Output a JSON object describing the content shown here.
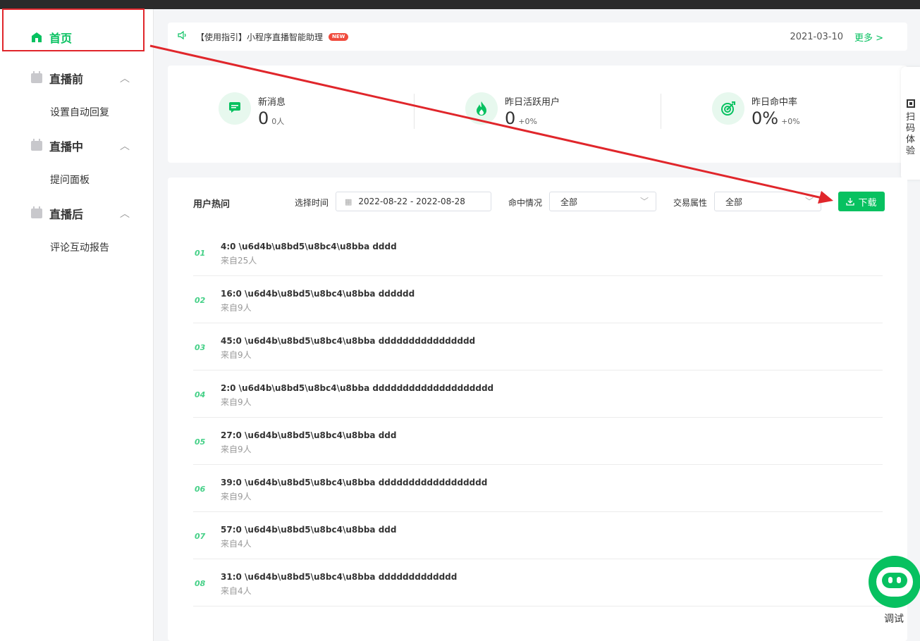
{
  "sidebar": {
    "home_label": "首页",
    "groups": [
      {
        "label": "直播前",
        "sub": "设置自动回复"
      },
      {
        "label": "直播中",
        "sub": "提问面板"
      },
      {
        "label": "直播后",
        "sub": "评论互动报告"
      }
    ]
  },
  "notice": {
    "text": "【使用指引】小程序直播智能助理",
    "badge": "NEW",
    "date": "2021-03-10",
    "more": "更多 >"
  },
  "stats": [
    {
      "title": "新消息",
      "value": "0",
      "sub": "0人"
    },
    {
      "title": "昨日活跃用户",
      "value": "0",
      "sub": "+0%"
    },
    {
      "title": "昨日命中率",
      "value": "0%",
      "sub": "+0%"
    }
  ],
  "side_float": {
    "text": "扫码体验"
  },
  "panel": {
    "title": "用户热问",
    "time_label": "选择时间",
    "date_range": "2022-08-22 - 2022-08-28",
    "hit_label": "命中情况",
    "hit_value": "全部",
    "trade_label": "交易属性",
    "trade_value": "全部",
    "download_label": "下载"
  },
  "questions": [
    {
      "num": "01",
      "title": "4:0 \\u6d4b\\u8bd5\\u8bc4\\u8bba dddd",
      "from": "来自25人"
    },
    {
      "num": "02",
      "title": "16:0 \\u6d4b\\u8bd5\\u8bc4\\u8bba dddddd",
      "from": "来自9人"
    },
    {
      "num": "03",
      "title": "45:0 \\u6d4b\\u8bd5\\u8bc4\\u8bba dddddddddddddddd",
      "from": "来自9人"
    },
    {
      "num": "04",
      "title": "2:0 \\u6d4b\\u8bd5\\u8bc4\\u8bba dddddddddddddddddddd",
      "from": "来自9人"
    },
    {
      "num": "05",
      "title": "27:0 \\u6d4b\\u8bd5\\u8bc4\\u8bba ddd",
      "from": "来自9人"
    },
    {
      "num": "06",
      "title": "39:0 \\u6d4b\\u8bd5\\u8bc4\\u8bba dddddddddddddddddd",
      "from": "来自9人"
    },
    {
      "num": "07",
      "title": "57:0 \\u6d4b\\u8bd5\\u8bc4\\u8bba ddd",
      "from": "来自4人"
    },
    {
      "num": "08",
      "title": "31:0 \\u6d4b\\u8bd5\\u8bc4\\u8bba ddddddddddddd",
      "from": "来自4人"
    }
  ],
  "bot": {
    "label": "调试"
  },
  "colors": {
    "accent": "#07c160",
    "annotation": "#e0262b"
  }
}
